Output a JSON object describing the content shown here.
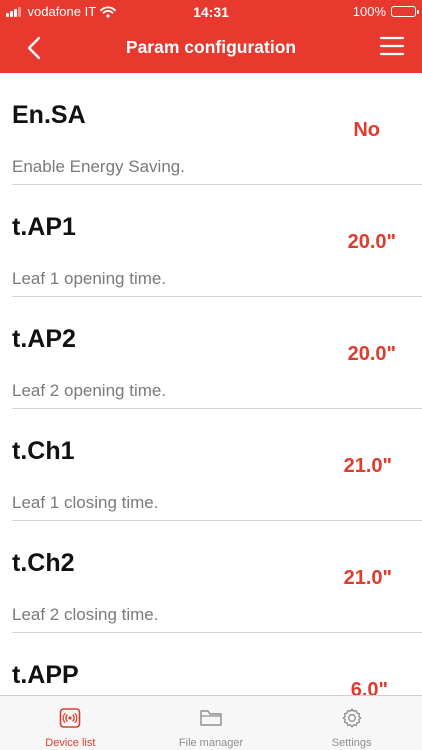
{
  "status_bar": {
    "carrier": "vodafone IT",
    "time": "14:31",
    "battery_percent": "100%",
    "icons": [
      "signal-icon",
      "wifi-icon",
      "battery-icon"
    ]
  },
  "nav": {
    "title": "Param configuration",
    "back_icon": "chevron-left-icon",
    "menu_icon": "hamburger-menu-icon"
  },
  "params": [
    {
      "code": "En.SA",
      "value": "No",
      "description": "Enable Energy Saving."
    },
    {
      "code": "t.AP1",
      "value": "20.0\"",
      "description": "Leaf 1 opening time."
    },
    {
      "code": "t.AP2",
      "value": "20.0\"",
      "description": "Leaf 2 opening time."
    },
    {
      "code": "t.Ch1",
      "value": "21.0\"",
      "description": "Leaf 1 closing time."
    },
    {
      "code": "t.Ch2",
      "value": "21.0\"",
      "description": "Leaf 2 closing time."
    },
    {
      "code": "t.APP",
      "value": "6.0\"",
      "description": ""
    }
  ],
  "tabs": [
    {
      "label": "Device list",
      "icon": "remote-control-icon",
      "active": true
    },
    {
      "label": "File manager",
      "icon": "folder-icon",
      "active": false
    },
    {
      "label": "Settings",
      "icon": "gear-icon",
      "active": false
    }
  ],
  "colors": {
    "header": "#e8392f",
    "value": "#e03c2d",
    "active_tab": "#e03c2d",
    "inactive_tab": "#8e8e8e"
  }
}
